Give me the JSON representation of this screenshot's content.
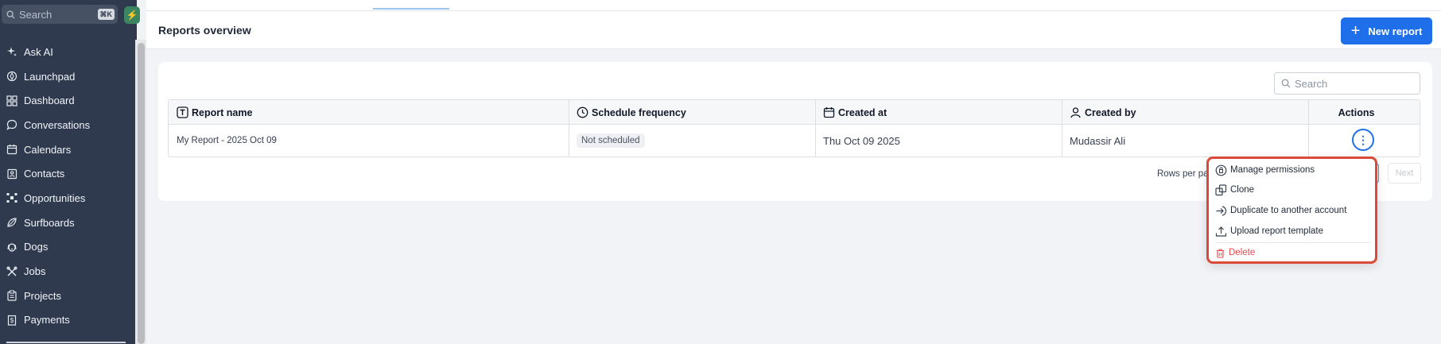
{
  "sidebar": {
    "search_placeholder": "Search",
    "search_shortcut": "⌘K",
    "bolt_icon": "bolt-icon",
    "items": [
      {
        "label": "Ask AI",
        "icon": "sparkle-icon"
      },
      {
        "label": "Launchpad",
        "icon": "rocket-icon"
      },
      {
        "label": "Dashboard",
        "icon": "grid-icon"
      },
      {
        "label": "Conversations",
        "icon": "chat-icon"
      },
      {
        "label": "Calendars",
        "icon": "calendar-icon"
      },
      {
        "label": "Contacts",
        "icon": "contacts-icon"
      },
      {
        "label": "Opportunities",
        "icon": "network-icon"
      },
      {
        "label": "Surfboards",
        "icon": "surfboard-icon"
      },
      {
        "label": "Dogs",
        "icon": "dog-icon"
      },
      {
        "label": "Jobs",
        "icon": "tools-icon"
      },
      {
        "label": "Projects",
        "icon": "clipboard-icon"
      },
      {
        "label": "Payments",
        "icon": "receipt-icon"
      }
    ]
  },
  "header": {
    "title": "Reports overview",
    "new_report_label": "New report"
  },
  "table": {
    "search_placeholder": "Search",
    "columns": [
      {
        "label": "Report name",
        "icon": "text-type-icon"
      },
      {
        "label": "Schedule frequency",
        "icon": "clock-icon"
      },
      {
        "label": "Created at",
        "icon": "calendar-icon"
      },
      {
        "label": "Created by",
        "icon": "user-icon"
      },
      {
        "label": "Actions",
        "icon": ""
      }
    ],
    "rows": [
      {
        "name": "My Report - 2025 Oct 09",
        "schedule": "Not scheduled",
        "created_at": "Thu Oct 09 2025",
        "created_by": "Mudassir Ali"
      }
    ],
    "actions_glyph": "⋮"
  },
  "pagination": {
    "rows_per_page_label": "Rows per pa",
    "next_label": "Next"
  },
  "menu": {
    "items": [
      {
        "label": "Manage permissions",
        "icon": "permissions-icon"
      },
      {
        "label": "Clone",
        "icon": "clone-icon"
      },
      {
        "label": "Duplicate to another account",
        "icon": "duplicate-icon"
      },
      {
        "label": "Upload report template",
        "icon": "upload-icon"
      }
    ],
    "delete_label": "Delete",
    "delete_color": "#e5484d"
  },
  "colors": {
    "sidebar_bg": "#2f3a4f",
    "primary": "#1f6feb",
    "menu_highlight": "#d94a3a"
  }
}
